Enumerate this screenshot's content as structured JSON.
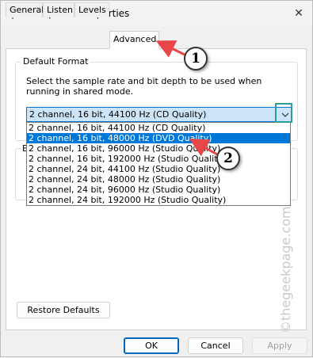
{
  "window": {
    "title": "Microphone Properties",
    "close_glyph": "✕"
  },
  "tabs": [
    {
      "label": "General"
    },
    {
      "label": "Listen"
    },
    {
      "label": "Levels"
    },
    {
      "label": "Advanced",
      "active": true
    }
  ],
  "default_format": {
    "legend": "Default Format",
    "description": "Select the sample rate and bit depth to be used when running in shared mode.",
    "selected_value": "2 channel, 16 bit, 44100 Hz (CD Quality)",
    "options": [
      "2 channel, 16 bit, 44100 Hz (CD Quality)",
      "2 channel, 16 bit, 48000 Hz (DVD Quality)",
      "2 channel, 16 bit, 96000 Hz (Studio Quality)",
      "2 channel, 16 bit, 192000 Hz (Studio Quality)",
      "2 channel, 24 bit, 44100 Hz (Studio Quality)",
      "2 channel, 24 bit, 48000 Hz (Studio Quality)",
      "2 channel, 24 bit, 96000 Hz (Studio Quality)",
      "2 channel, 24 bit, 192000 Hz (Studio Quality)"
    ],
    "highlighted_index": 1
  },
  "second_group_letter": "E",
  "buttons": {
    "restore": "Restore Defaults",
    "ok": "OK",
    "cancel": "Cancel",
    "apply": "Apply"
  },
  "annotations": {
    "one": "1",
    "two": "2",
    "color_ring": "#333333",
    "arrow_color": "#e8474a",
    "highlight_color": "#2aa198"
  },
  "watermark": "©thegeekpage.com",
  "colors": {
    "selection": "#0078d7",
    "combo_bg": "#cce4f7"
  }
}
